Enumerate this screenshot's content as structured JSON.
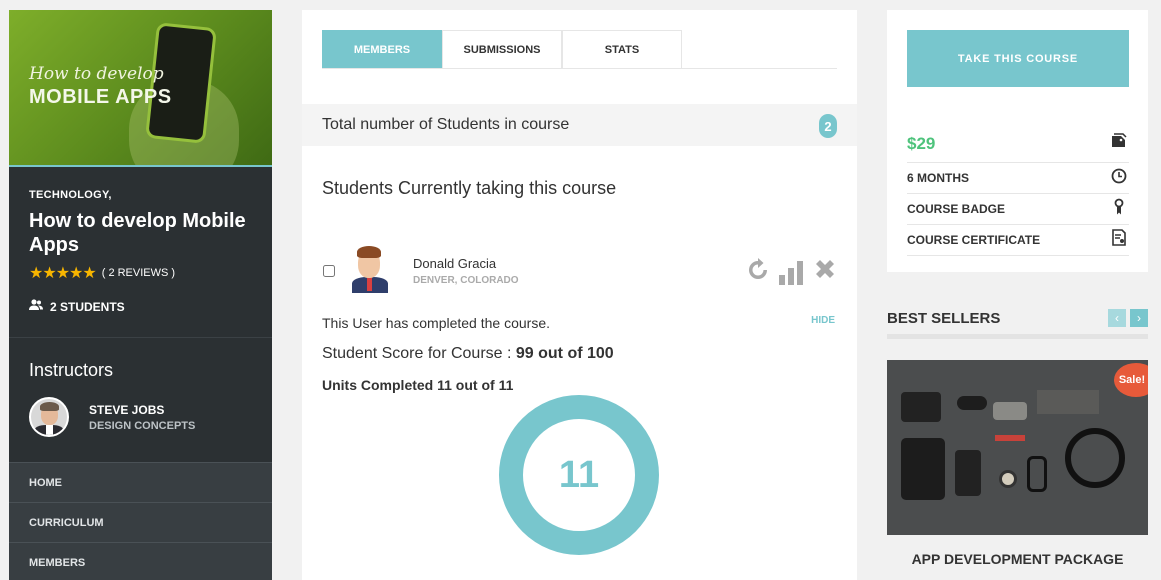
{
  "sidebar": {
    "image_text_line1": "How to develop",
    "image_text_line2": "MOBILE APPS",
    "category": "TECHNOLOGY,",
    "course_title": "How to develop Mobile Apps",
    "stars": "★★★★★",
    "reviews": "( 2 REVIEWS )",
    "students": "2 STUDENTS",
    "instructors_heading": "Instructors",
    "instructor_name": "STEVE JOBS",
    "instructor_subtitle": "DESIGN CONCEPTS",
    "menu": [
      "HOME",
      "CURRICULUM",
      "MEMBERS"
    ]
  },
  "main": {
    "tabs": [
      "MEMBERS",
      "SUBMISSIONS",
      "STATS"
    ],
    "total_label": "Total number of Students in course",
    "total_count": "2",
    "subheading": "Students Currently taking this course",
    "member": {
      "name": "Donald Gracia",
      "location": "DENVER, COLORADO"
    },
    "completed_text": "This User has completed the course.",
    "hide_link": "HIDE",
    "score_label": "Student Score for Course : ",
    "score_value": "99 out of 100",
    "units_text": "Units Completed 11 out of 11",
    "units_ring_value": "11",
    "units_completed_fraction": 1.0
  },
  "right": {
    "take_button": "TAKE THIS COURSE",
    "price": "$29",
    "duration": "6 MONTHS",
    "badge": "COURSE BADGE",
    "certificate": "COURSE CERTIFICATE",
    "best_sellers": "BEST SELLERS",
    "prev_arrow": "‹",
    "next_arrow": "›",
    "sale_badge": "Sale!",
    "product_name": "APP DEVELOPMENT PACKAGE"
  },
  "colors": {
    "accent": "#78c6cd",
    "price_green": "#4ec37c",
    "sidebar_bg": "#2b3033",
    "sale_red": "#e75a3a",
    "star_yellow": "#f7b500"
  },
  "icons": {
    "students": "users-icon",
    "refresh": "refresh-icon",
    "stats": "bar-chart-icon",
    "remove": "close-icon",
    "price": "price-tag-icon",
    "duration": "clock-icon",
    "badge": "badge-icon",
    "certificate": "certificate-icon"
  }
}
